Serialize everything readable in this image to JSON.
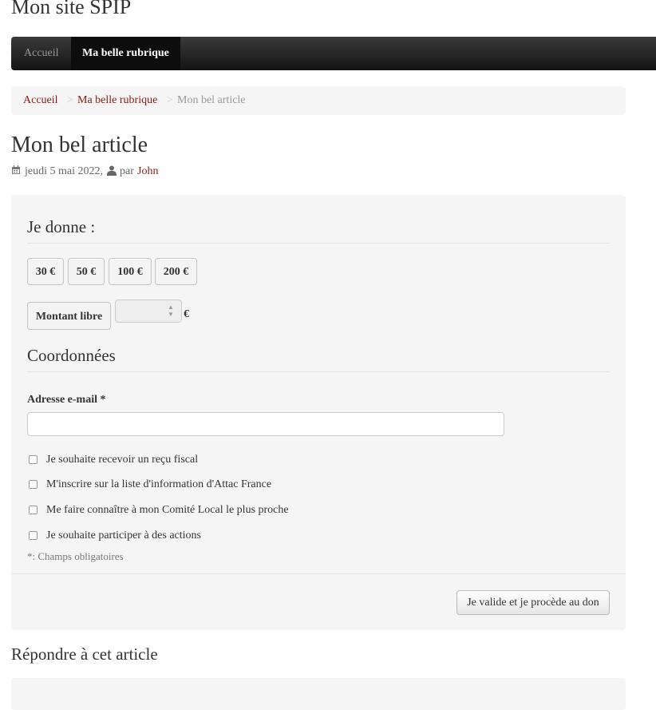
{
  "site": {
    "title": "Mon site SPIP"
  },
  "nav": {
    "items": [
      {
        "label": "Accueil"
      },
      {
        "label": "Ma belle rubrique"
      }
    ]
  },
  "breadcrumb": {
    "separator": ">",
    "items": [
      {
        "label": "Accueil"
      },
      {
        "label": "Ma belle rubrique"
      },
      {
        "label": "Mon bel article"
      }
    ]
  },
  "article": {
    "title": "Mon bel article",
    "date": "jeudi 5 mai 2022,",
    "by": "par",
    "author": "John"
  },
  "donation": {
    "legend": "Je donne :",
    "amounts": [
      "30 €",
      "50 €",
      "100 €",
      "200 €"
    ],
    "free_amount_label": "Montant libre",
    "free_amount_value": "",
    "currency": "€"
  },
  "coords": {
    "legend": "Coordonnées",
    "email_label": "Adresse e-mail",
    "required_mark": "*",
    "email_value": "",
    "checkboxes": [
      {
        "label": "Je souhaite recevoir un reçu fiscal",
        "checked": false
      },
      {
        "label": "M'inscrire sur la liste d'information d'Attac France",
        "checked": false
      },
      {
        "label": "Me faire connaître à mon Comité Local le plus proche",
        "checked": false
      },
      {
        "label": "Je souhaite participer à des actions",
        "checked": false
      }
    ],
    "required_note": "*: Champs obligatoires"
  },
  "submit": {
    "label": "Je valide et je procède au don"
  },
  "reply": {
    "title": "Répondre à cet article"
  },
  "colors": {
    "link": "#8b1a10",
    "navbar": "#1b1b1b",
    "panel": "#f5f5f5"
  },
  "icons": {
    "date": "calendar-icon",
    "author": "user-icon"
  }
}
